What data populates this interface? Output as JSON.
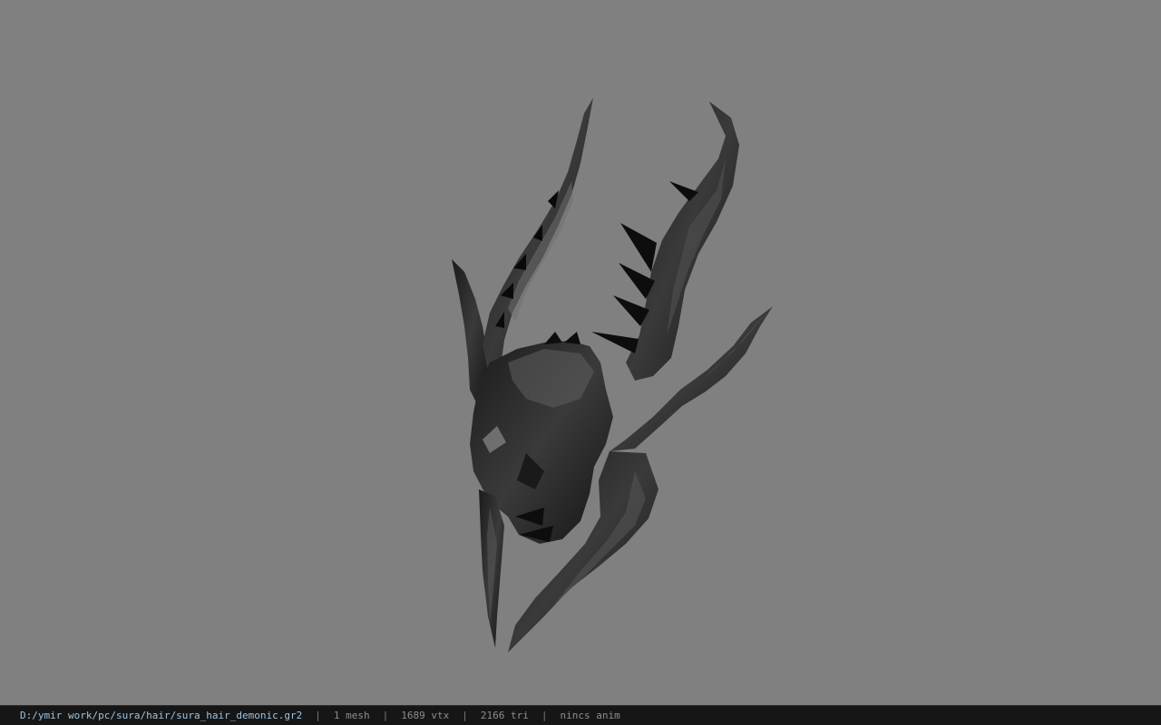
{
  "status_bar": {
    "file_path": "D:/ymir work/pc/sura/hair/sura_hair_demonic.gr2",
    "separator": "|",
    "mesh_count": "1 mesh",
    "vertex_count": "1689 vtx",
    "triangle_count": "2166 tri",
    "anim_status": "nincs anim"
  },
  "colors": {
    "viewport_background": "#808080",
    "status_bar_background": "#161616",
    "path_text": "#9fc3df",
    "stat_text": "#8e8e8e"
  }
}
